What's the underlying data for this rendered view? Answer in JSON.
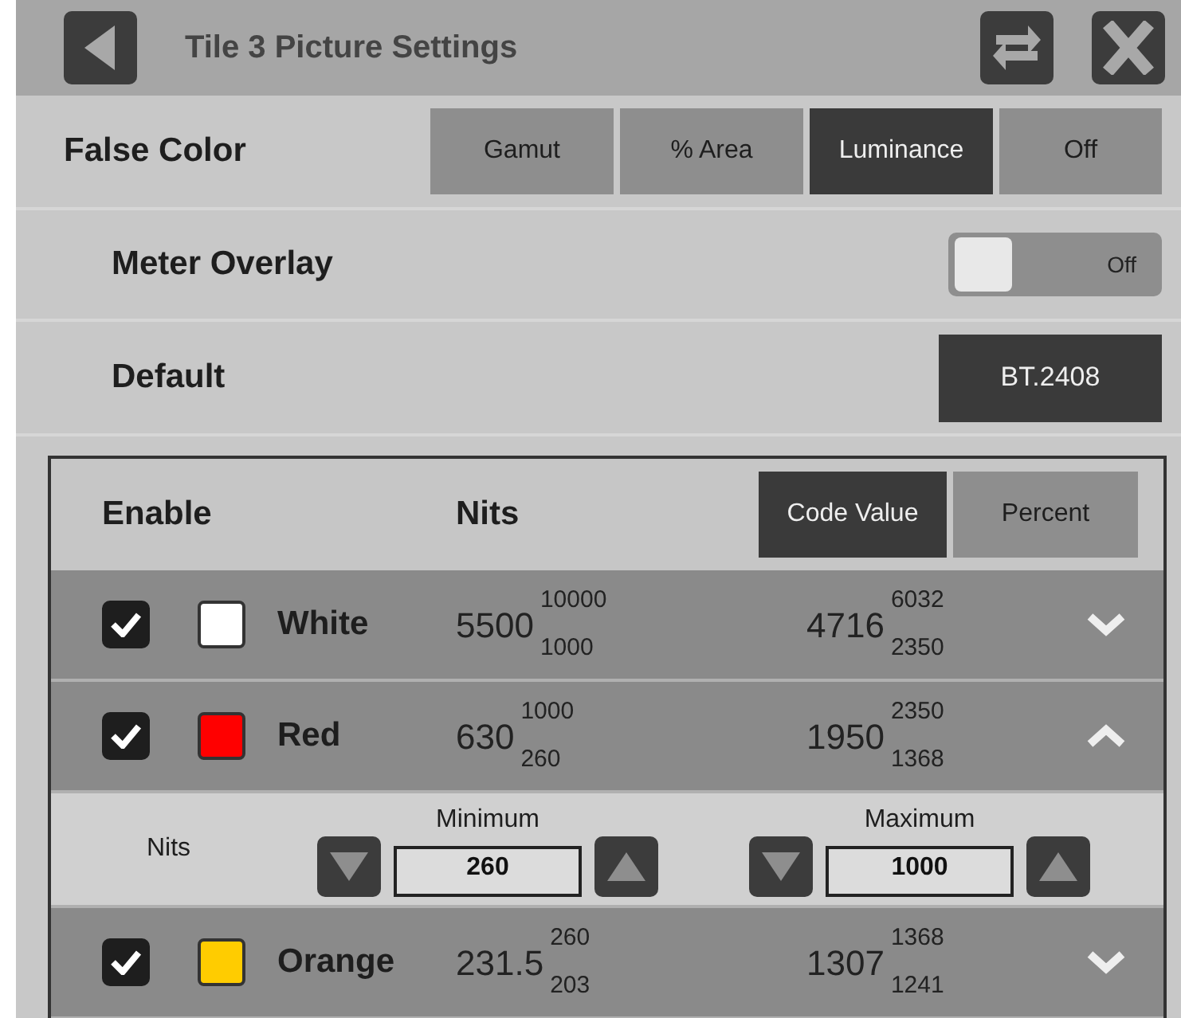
{
  "header": {
    "title": "Tile 3 Picture Settings"
  },
  "false_color": {
    "label": "False Color",
    "options": [
      {
        "label": "Gamut",
        "selected": false
      },
      {
        "label": "% Area",
        "selected": false
      },
      {
        "label": "Luminance",
        "selected": true
      },
      {
        "label": "Off",
        "selected": false
      }
    ]
  },
  "meter_overlay": {
    "label": "Meter Overlay",
    "toggle": {
      "on": false,
      "label": "Off"
    }
  },
  "default": {
    "label": "Default",
    "button": "BT.2408"
  },
  "table": {
    "columns": [
      "Enable",
      "Nits"
    ],
    "units": [
      {
        "label": "Code Value",
        "selected": true
      },
      {
        "label": "Percent",
        "selected": false
      }
    ],
    "rows": [
      {
        "checked": true,
        "color": "#ffffff",
        "name": "White",
        "nits": "5500",
        "nits_max": "10000",
        "nits_min": "1000",
        "code": "4716",
        "code_max": "6032",
        "code_min": "2350",
        "expanded": false
      },
      {
        "checked": true,
        "color": "#ff0000",
        "name": "Red",
        "nits": "630",
        "nits_max": "1000",
        "nits_min": "260",
        "code": "1950",
        "code_max": "2350",
        "code_min": "1368",
        "expanded": true,
        "editor": {
          "label": "Nits",
          "minimum": {
            "label": "Minimum",
            "value": "260"
          },
          "maximum": {
            "label": "Maximum",
            "value": "1000"
          }
        }
      },
      {
        "checked": true,
        "color": "#ffcc00",
        "name": "Orange",
        "nits": "231.5",
        "nits_max": "260",
        "nits_min": "203",
        "code": "1307",
        "code_max": "1368",
        "code_min": "1241",
        "expanded": false
      }
    ]
  }
}
